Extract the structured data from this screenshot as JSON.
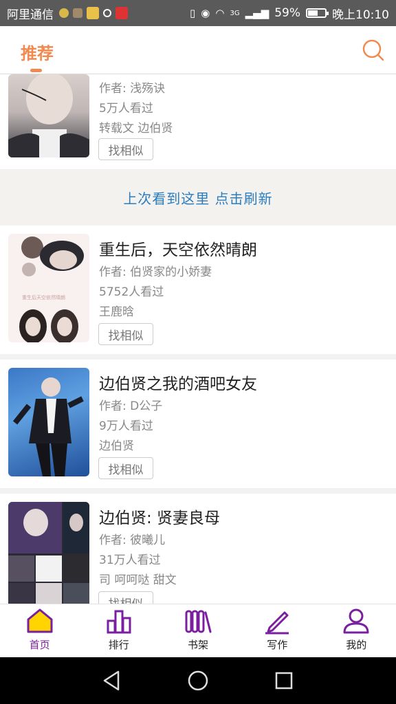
{
  "status_bar": {
    "carrier": "阿里通信",
    "network": "3G",
    "battery": "59%",
    "battery_level": 0.59,
    "time": "晚上10:10"
  },
  "header": {
    "tab_label": "推荐",
    "accent_color": "#f08a50"
  },
  "feed": {
    "similar_label": "找相似",
    "refresh_text": "上次看到这里  点击刷新",
    "items": [
      {
        "title": "",
        "author": "作者: 浅殇诀",
        "views": "5万人看过",
        "tags": "转载文  边伯贤"
      },
      {
        "title": "重生后，天空依然晴朗",
        "author": "作者: 伯贤家的小娇妻",
        "views": "5752人看过",
        "tags": "王鹿晗"
      },
      {
        "title": "边伯贤之我的酒吧女友",
        "author": "作者: D公子",
        "views": "9万人看过",
        "tags": "边伯贤"
      },
      {
        "title": "边伯贤: 贤妻良母",
        "author": "作者: 彼曦儿",
        "views": "31万人看过",
        "tags": "司  呵呵哒  甜文"
      }
    ]
  },
  "bottom_nav": {
    "active_color": "#7a1fa0",
    "items": [
      {
        "label": "首页",
        "icon": "home-icon"
      },
      {
        "label": "排行",
        "icon": "ranking-icon"
      },
      {
        "label": "书架",
        "icon": "bookshelf-icon"
      },
      {
        "label": "写作",
        "icon": "pen-icon"
      },
      {
        "label": "我的",
        "icon": "user-icon"
      }
    ]
  }
}
